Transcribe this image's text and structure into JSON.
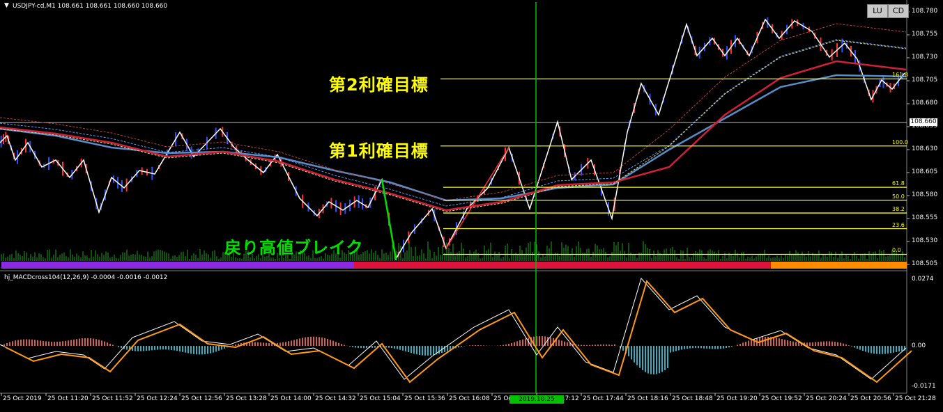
{
  "header": {
    "symbol_info": "USDJPY-cd,M1  108.661 108.661 108.660 108.660",
    "lu_button": "LU",
    "cd_button": "CD"
  },
  "annotations": {
    "target2": "第2利確目標",
    "target1": "第1利確目標",
    "break_label": "戻り高値ブレイク"
  },
  "price_axis": {
    "labels": [
      "108.780",
      "108.755",
      "108.730",
      "108.705",
      "108.680",
      "108.655",
      "108.630",
      "108.605",
      "108.580",
      "108.555",
      "108.530",
      "108.505"
    ],
    "current_price": "108.660"
  },
  "fibonacci": {
    "levels": [
      {
        "label": "161.8",
        "price": 108.707
      },
      {
        "label": "100.0",
        "price": 108.634
      },
      {
        "label": "61.8",
        "price": 108.589
      },
      {
        "label": "50.0",
        "price": 108.575
      },
      {
        "label": "38.2",
        "price": 108.561
      },
      {
        "label": "23.6",
        "price": 108.544
      },
      {
        "label": "0.0",
        "price": 108.516
      }
    ]
  },
  "indicator": {
    "title": "hj_MACDcross104(12,26,9) -0.0004 -0.0016 -0.0012",
    "axis_labels": [
      "0.0274",
      "0.00",
      "-0.0171"
    ]
  },
  "time_axis": {
    "labels": [
      "25 Oct 2019",
      "25 Oct 11:20",
      "25 Oct 11:52",
      "25 Oct 12:24",
      "25 Oct 12:56",
      "25 Oct 13:28",
      "25 Oct 14:00",
      "25 Oct 14:32",
      "25 Oct 15:04",
      "25 Oct 15:36",
      "25 Oct 16:08",
      "25 Oct 16:",
      "25 Oct 17:12",
      "25 Oct 17:44",
      "25 Oct 18:16",
      "25 Oct 18:48",
      "25 Oct 19:20",
      "25 Oct 19:52",
      "25 Oct 20:24",
      "25 Oct 20:56",
      "25 Oct 21:28"
    ],
    "crosshair_time": "2019.10.25 17:12"
  },
  "colors": {
    "background": "#000000",
    "fib_line": "#ffff00",
    "crosshair": "#00c000",
    "ma_red": "#d0203a",
    "ma_blue": "#5a8cc8",
    "annotation_yellow": "#ffff00",
    "annotation_green": "#00e000"
  }
}
